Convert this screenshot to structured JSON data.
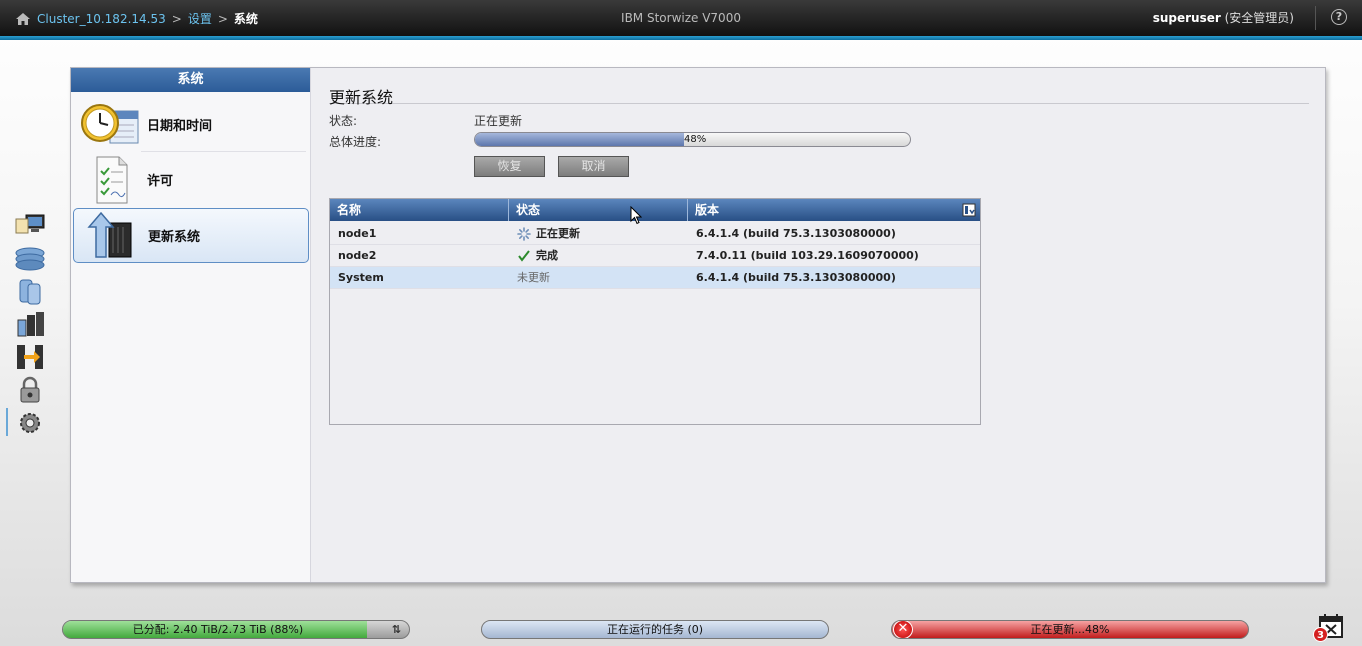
{
  "topbar": {
    "breadcrumb": [
      "Cluster_10.182.14.53",
      "设置",
      "系统"
    ],
    "separator": ">",
    "product": "IBM Storwize V7000",
    "user_name": "superuser",
    "user_role": "(安全管理员)",
    "help_icon": "?"
  },
  "side": {
    "header": "系统",
    "items": [
      {
        "label": "日期和时间",
        "icon": "clock-calendar-icon"
      },
      {
        "label": "许可",
        "icon": "license-document-icon"
      },
      {
        "label": "更新系统",
        "icon": "update-system-icon",
        "active": true
      }
    ]
  },
  "content": {
    "title": "更新系统",
    "status_label": "状态:",
    "status_value": "正在更新",
    "progress_label": "总体进度:",
    "progress_percent": 48,
    "progress_text": "48%",
    "buttons": {
      "resume": "恢复",
      "cancel": "取消"
    }
  },
  "table": {
    "columns": [
      "名称",
      "状态",
      "版本"
    ],
    "rows": [
      {
        "name": "node1",
        "status": "正在更新",
        "status_icon": "spinner-icon",
        "version": "6.4.1.4 (build 75.3.1303080000)"
      },
      {
        "name": "node2",
        "status": "完成",
        "status_icon": "checkmark-icon",
        "version": "7.4.0.11 (build 103.29.1609070000)"
      },
      {
        "name": "System",
        "status": "未更新",
        "status_icon": "",
        "version": "6.4.1.4 (build 75.3.1303080000)",
        "selected": true
      }
    ]
  },
  "statusbar": {
    "allocated": "已分配: 2.40 TiB/2.73 TiB (88%)",
    "allocated_percent": 88,
    "running_tasks": "正在运行的任务 (0)",
    "updating": "正在更新...48%",
    "alert_count": "3"
  },
  "colors": {
    "accent": "#1a8fc4",
    "header_blue": "#2c5c98",
    "error_red": "#c11c1c",
    "ok_green": "#43a93d"
  }
}
